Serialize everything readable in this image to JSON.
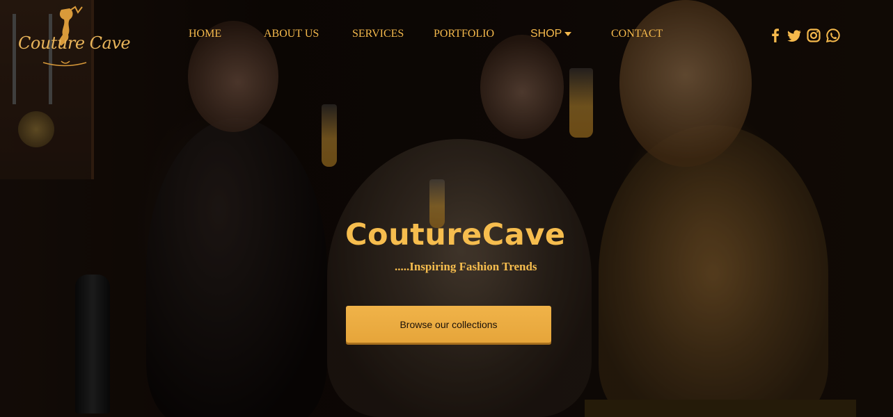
{
  "brand": {
    "logo_text": "Couture Cave",
    "title": "CoutureCave",
    "tagline": ".....Inspiring Fashion Trends"
  },
  "nav": {
    "items": [
      {
        "label": "HOME"
      },
      {
        "label": "ABOUT US"
      },
      {
        "label": "SERVICES"
      },
      {
        "label": "PORTFOLIO"
      },
      {
        "label": "SHOP",
        "has_dropdown": true
      },
      {
        "label": "CONTACT"
      }
    ]
  },
  "social": [
    {
      "icon": "facebook-icon"
    },
    {
      "icon": "twitter-icon"
    },
    {
      "icon": "instagram-icon"
    },
    {
      "icon": "whatsapp-icon"
    }
  ],
  "hero": {
    "cta_label": "Browse our collections"
  },
  "colors": {
    "accent": "#f6bd4e",
    "button_bg": "#eaa93f",
    "background": "#120a06"
  }
}
